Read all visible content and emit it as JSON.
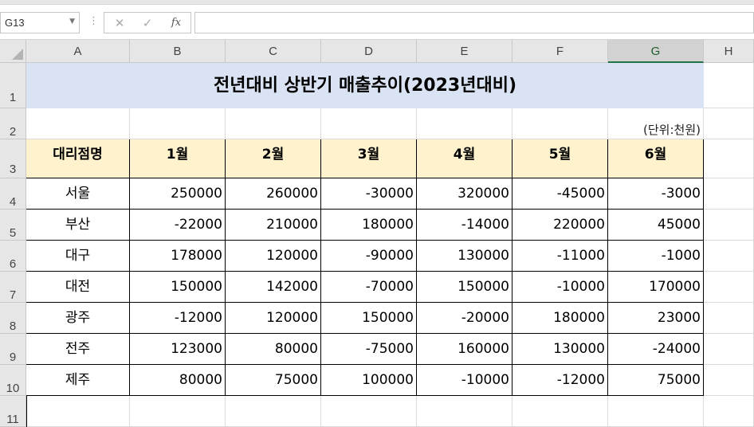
{
  "formula_bar": {
    "name_box": "G13",
    "fx_label": "fx",
    "formula": ""
  },
  "columns": [
    "A",
    "B",
    "C",
    "D",
    "E",
    "F",
    "G",
    "H"
  ],
  "rows": [
    "1",
    "2",
    "3",
    "4",
    "5",
    "6",
    "7",
    "8",
    "9",
    "10",
    "11"
  ],
  "selected_column": "G",
  "selected_row": "13",
  "sheet": {
    "title": "전년대비 상반기 매출추이(2023년대비)",
    "unit": "(단위:천원)",
    "table": {
      "headers": [
        "대리점명",
        "1월",
        "2월",
        "3월",
        "4월",
        "5월",
        "6월"
      ],
      "rows": [
        [
          "서울",
          "250000",
          "260000",
          "-30000",
          "320000",
          "-45000",
          "-3000"
        ],
        [
          "부산",
          "-22000",
          "210000",
          "180000",
          "-14000",
          "220000",
          "45000"
        ],
        [
          "대구",
          "178000",
          "120000",
          "-90000",
          "130000",
          "-11000",
          "-1000"
        ],
        [
          "대전",
          "150000",
          "142000",
          "-70000",
          "150000",
          "-10000",
          "170000"
        ],
        [
          "광주",
          "-12000",
          "120000",
          "150000",
          "-20000",
          "180000",
          "23000"
        ],
        [
          "전주",
          "123000",
          "80000",
          "-75000",
          "160000",
          "130000",
          "-24000"
        ],
        [
          "제주",
          "80000",
          "75000",
          "100000",
          "-10000",
          "-12000",
          "75000"
        ]
      ]
    }
  },
  "colors": {
    "title_fill": "#dae3f3",
    "header_fill": "#fff2cc",
    "selection_accent": "#217346"
  }
}
